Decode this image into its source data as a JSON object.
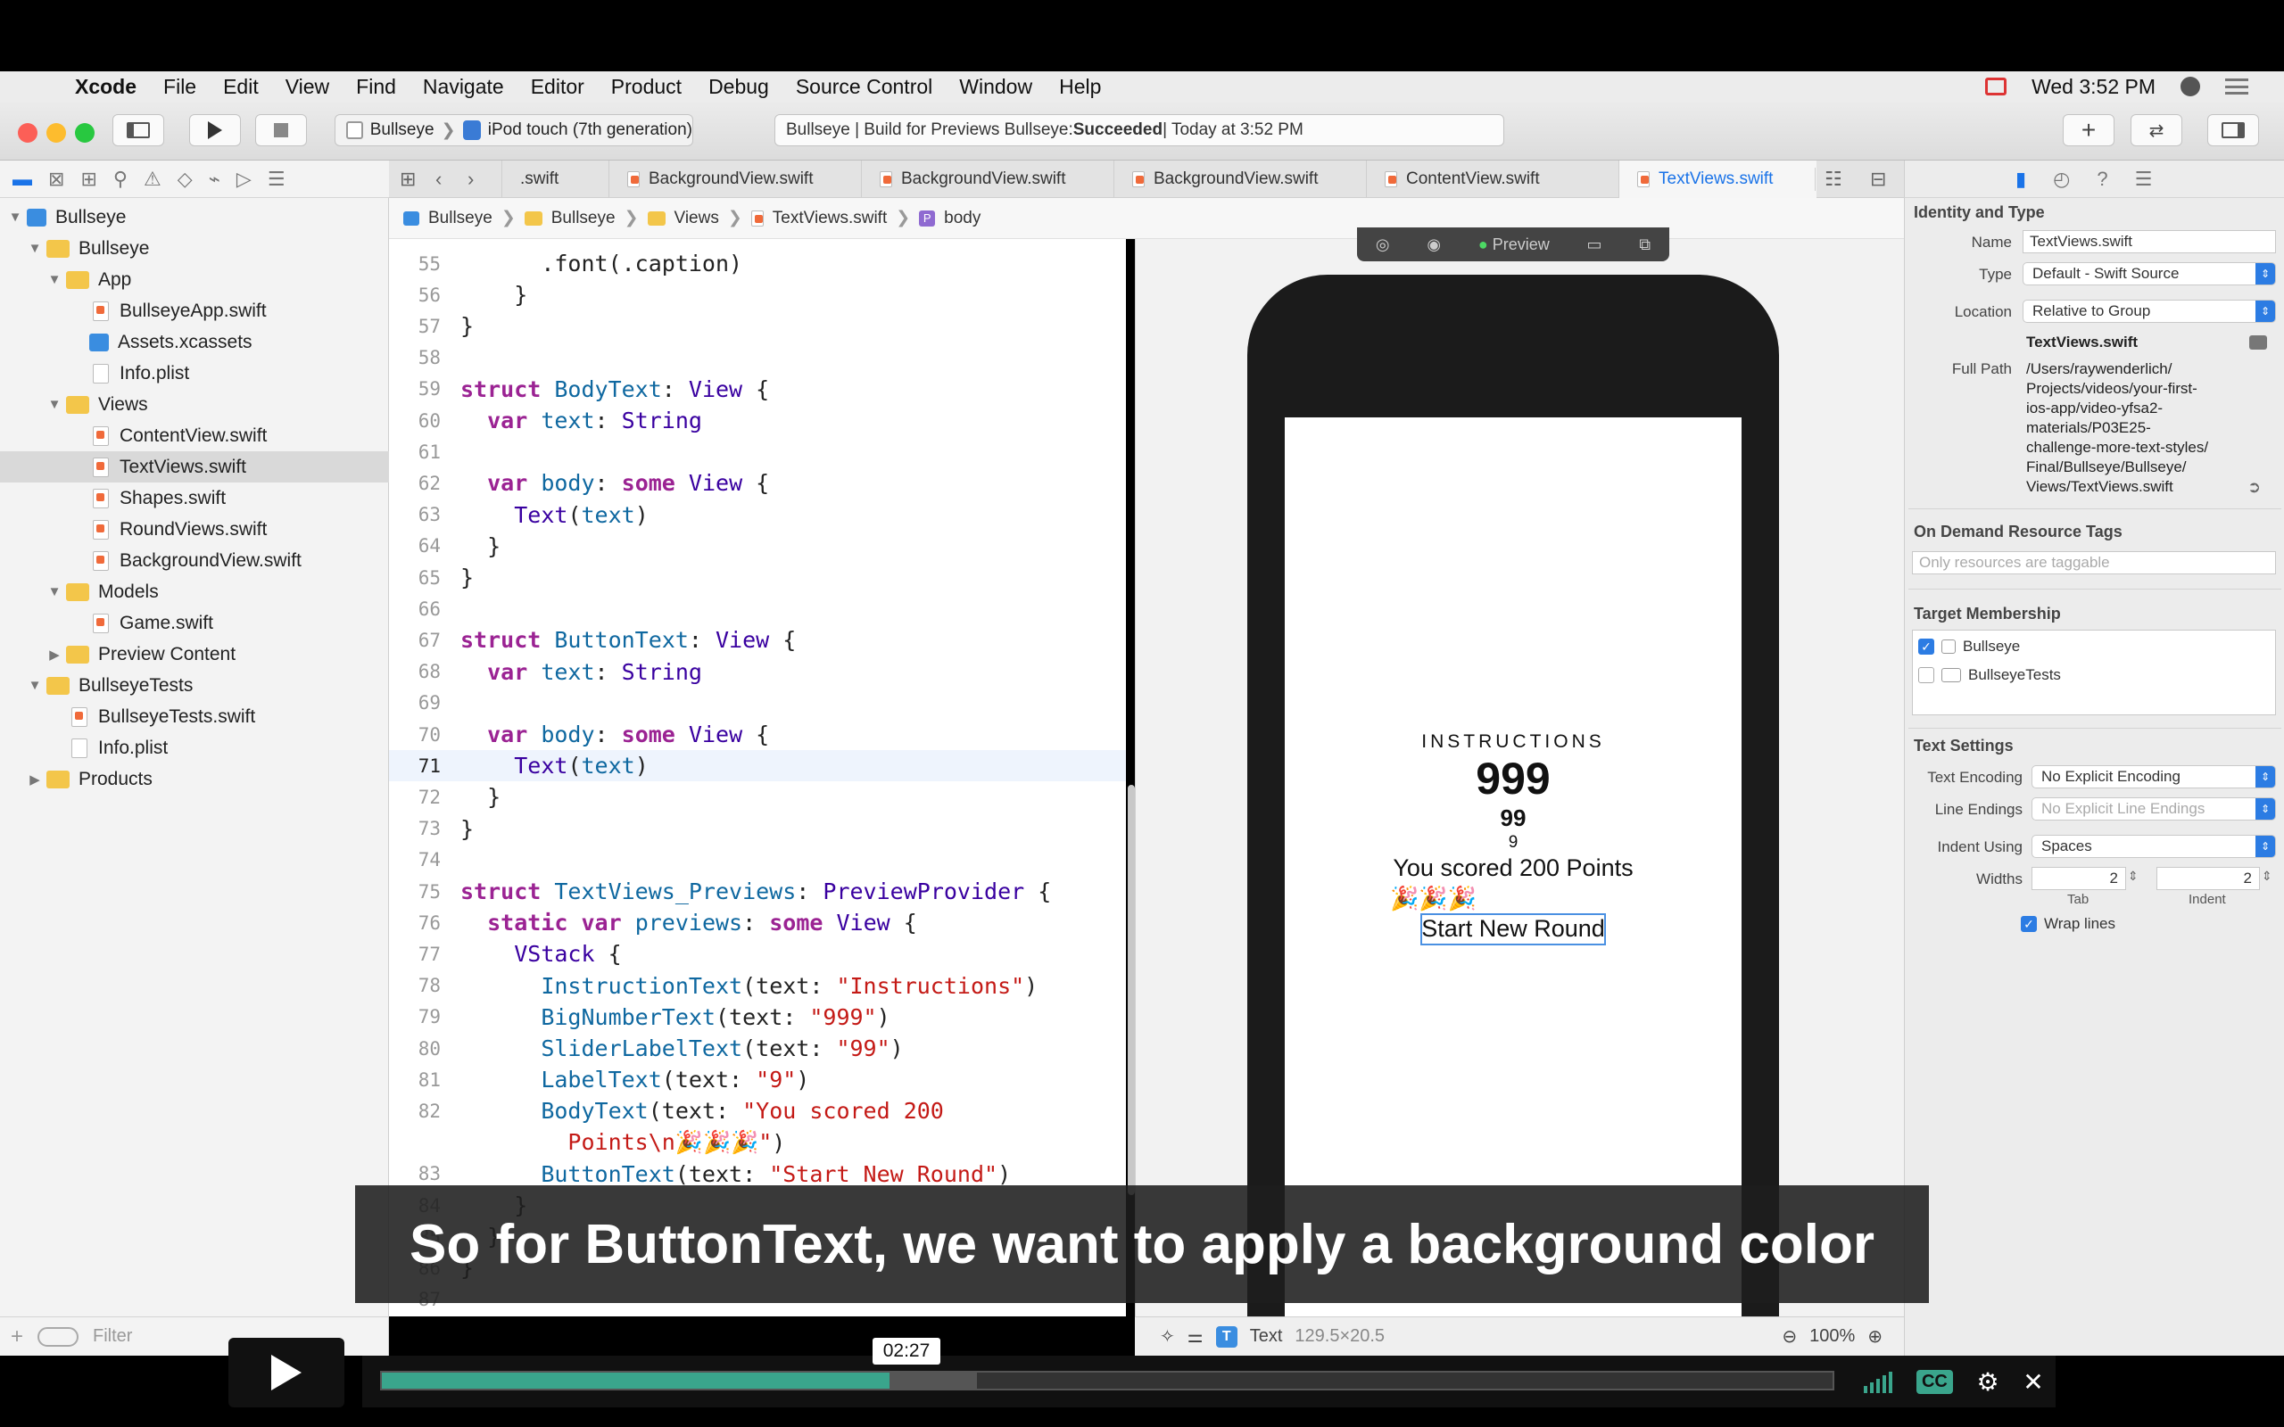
{
  "menubar": {
    "app": "Xcode",
    "items": [
      "File",
      "Edit",
      "View",
      "Find",
      "Navigate",
      "Editor",
      "Product",
      "Debug",
      "Source Control",
      "Window",
      "Help"
    ],
    "clock": "Wed 3:52 PM"
  },
  "toolbar": {
    "scheme": "Bullseye",
    "device": "iPod touch (7th generation)",
    "status_prefix": "Bullseye | Build for Previews Bullseye: ",
    "status_result": "Succeeded",
    "status_time": " | Today at 3:52 PM"
  },
  "tabs": [
    {
      "label": ".swift"
    },
    {
      "label": "BackgroundView.swift"
    },
    {
      "label": "BackgroundView.swift"
    },
    {
      "label": "BackgroundView.swift"
    },
    {
      "label": "ContentView.swift"
    },
    {
      "label": "TextViews.swift",
      "active": true
    }
  ],
  "breadcrumb": [
    "Bullseye",
    "Bullseye",
    "Views",
    "TextViews.swift",
    "body"
  ],
  "navigator": {
    "items": [
      {
        "label": "Bullseye",
        "type": "project"
      },
      {
        "label": "Bullseye",
        "type": "folder"
      },
      {
        "label": "App",
        "type": "folder"
      },
      {
        "label": "BullseyeApp.swift",
        "type": "swift"
      },
      {
        "label": "Assets.xcassets",
        "type": "assets"
      },
      {
        "label": "Info.plist",
        "type": "file"
      },
      {
        "label": "Views",
        "type": "folder"
      },
      {
        "label": "ContentView.swift",
        "type": "swift"
      },
      {
        "label": "TextViews.swift",
        "type": "swift",
        "selected": true
      },
      {
        "label": "Shapes.swift",
        "type": "swift"
      },
      {
        "label": "RoundViews.swift",
        "type": "swift"
      },
      {
        "label": "BackgroundView.swift",
        "type": "swift"
      },
      {
        "label": "Models",
        "type": "folder"
      },
      {
        "label": "Game.swift",
        "type": "swift"
      },
      {
        "label": "Preview Content",
        "type": "folder"
      },
      {
        "label": "BullseyeTests",
        "type": "folder"
      },
      {
        "label": "BullseyeTests.swift",
        "type": "swift"
      },
      {
        "label": "Info.plist",
        "type": "file"
      },
      {
        "label": "Products",
        "type": "folder"
      }
    ],
    "filter_placeholder": "Filter"
  },
  "code": {
    "current_line": "71",
    "lines": [
      {
        "n": "55",
        "tokens": [
          [
            "      ",
            ""
          ],
          [
            ".font(.caption)",
            ""
          ]
        ]
      },
      {
        "n": "56",
        "tokens": [
          [
            "    }",
            ""
          ]
        ]
      },
      {
        "n": "57",
        "tokens": [
          [
            "}",
            ""
          ]
        ]
      },
      {
        "n": "58",
        "tokens": []
      },
      {
        "n": "59",
        "tokens": [
          [
            "struct",
            "k"
          ],
          [
            " BodyText",
            "f"
          ],
          [
            ": ",
            ""
          ],
          [
            "View",
            "t"
          ],
          [
            " {",
            ""
          ]
        ]
      },
      {
        "n": "60",
        "tokens": [
          [
            "  ",
            ""
          ],
          [
            "var",
            "k"
          ],
          [
            " text",
            "f"
          ],
          [
            ": ",
            ""
          ],
          [
            "String",
            "t"
          ]
        ]
      },
      {
        "n": "61",
        "tokens": []
      },
      {
        "n": "62",
        "tokens": [
          [
            "  ",
            ""
          ],
          [
            "var",
            "k"
          ],
          [
            " body",
            "f"
          ],
          [
            ": ",
            ""
          ],
          [
            "some",
            "k"
          ],
          [
            " View",
            "t"
          ],
          [
            " {",
            ""
          ]
        ]
      },
      {
        "n": "63",
        "tokens": [
          [
            "    ",
            ""
          ],
          [
            "Text",
            "t"
          ],
          [
            "(",
            ""
          ],
          [
            "text",
            "f"
          ],
          [
            ")",
            ""
          ]
        ]
      },
      {
        "n": "64",
        "tokens": [
          [
            "  }",
            ""
          ]
        ]
      },
      {
        "n": "65",
        "tokens": [
          [
            "}",
            ""
          ]
        ]
      },
      {
        "n": "66",
        "tokens": []
      },
      {
        "n": "67",
        "tokens": [
          [
            "struct",
            "k"
          ],
          [
            " ButtonText",
            "f"
          ],
          [
            ": ",
            ""
          ],
          [
            "View",
            "t"
          ],
          [
            " {",
            ""
          ]
        ]
      },
      {
        "n": "68",
        "tokens": [
          [
            "  ",
            ""
          ],
          [
            "var",
            "k"
          ],
          [
            " text",
            "f"
          ],
          [
            ": ",
            ""
          ],
          [
            "String",
            "t"
          ]
        ]
      },
      {
        "n": "69",
        "tokens": []
      },
      {
        "n": "70",
        "tokens": [
          [
            "  ",
            ""
          ],
          [
            "var",
            "k"
          ],
          [
            " body",
            "f"
          ],
          [
            ": ",
            ""
          ],
          [
            "some",
            "k"
          ],
          [
            " View",
            "t"
          ],
          [
            " {",
            ""
          ]
        ]
      },
      {
        "n": "71",
        "tokens": [
          [
            "    ",
            ""
          ],
          [
            "Text",
            "t"
          ],
          [
            "(",
            ""
          ],
          [
            "text",
            "f"
          ],
          [
            ")",
            ""
          ]
        ]
      },
      {
        "n": "72",
        "tokens": [
          [
            "  }",
            ""
          ]
        ]
      },
      {
        "n": "73",
        "tokens": [
          [
            "}",
            ""
          ]
        ]
      },
      {
        "n": "74",
        "tokens": []
      },
      {
        "n": "75",
        "tokens": [
          [
            "struct",
            "k"
          ],
          [
            " TextViews_Previews",
            "f"
          ],
          [
            ": ",
            ""
          ],
          [
            "PreviewProvider",
            "t"
          ],
          [
            " {",
            ""
          ]
        ]
      },
      {
        "n": "76",
        "tokens": [
          [
            "  ",
            ""
          ],
          [
            "static",
            "k"
          ],
          [
            " ",
            ""
          ],
          [
            "var",
            "k"
          ],
          [
            " previews",
            "f"
          ],
          [
            ": ",
            ""
          ],
          [
            "some",
            "k"
          ],
          [
            " View",
            "t"
          ],
          [
            " {",
            ""
          ]
        ]
      },
      {
        "n": "77",
        "tokens": [
          [
            "    ",
            ""
          ],
          [
            "VStack",
            "t"
          ],
          [
            " {",
            ""
          ]
        ]
      },
      {
        "n": "78",
        "tokens": [
          [
            "      ",
            ""
          ],
          [
            "InstructionText",
            "f"
          ],
          [
            "(text: ",
            ""
          ],
          [
            "\"Instructions\"",
            "s"
          ],
          [
            ")",
            ""
          ]
        ]
      },
      {
        "n": "79",
        "tokens": [
          [
            "      ",
            ""
          ],
          [
            "BigNumberText",
            "f"
          ],
          [
            "(text: ",
            ""
          ],
          [
            "\"999\"",
            "s"
          ],
          [
            ")",
            ""
          ]
        ]
      },
      {
        "n": "80",
        "tokens": [
          [
            "      ",
            ""
          ],
          [
            "SliderLabelText",
            "f"
          ],
          [
            "(text: ",
            ""
          ],
          [
            "\"99\"",
            "s"
          ],
          [
            ")",
            ""
          ]
        ]
      },
      {
        "n": "81",
        "tokens": [
          [
            "      ",
            ""
          ],
          [
            "LabelText",
            "f"
          ],
          [
            "(text: ",
            ""
          ],
          [
            "\"9\"",
            "s"
          ],
          [
            ")",
            ""
          ]
        ]
      },
      {
        "n": "82",
        "tokens": [
          [
            "      ",
            ""
          ],
          [
            "BodyText",
            "f"
          ],
          [
            "(text: ",
            ""
          ],
          [
            "\"You scored 200",
            "s"
          ]
        ]
      },
      {
        "n": "",
        "tokens": [
          [
            "        ",
            ""
          ],
          [
            "Points\\n🎉🎉🎉\"",
            "s"
          ],
          [
            ")",
            ""
          ]
        ]
      },
      {
        "n": "83",
        "tokens": [
          [
            "      ",
            ""
          ],
          [
            "ButtonText",
            "f"
          ],
          [
            "(text: ",
            ""
          ],
          [
            "\"Start New Round\"",
            "s"
          ],
          [
            ")",
            ""
          ]
        ]
      },
      {
        "n": "84",
        "tokens": [
          [
            "    }",
            ""
          ]
        ]
      },
      {
        "n": "85",
        "tokens": [
          [
            "  }",
            ""
          ]
        ]
      },
      {
        "n": "86",
        "tokens": [
          [
            "}",
            ""
          ]
        ]
      },
      {
        "n": "87",
        "tokens": []
      }
    ]
  },
  "preview": {
    "toolbar_label": "Preview",
    "instructions": "INSTRUCTIONS",
    "big_number": "999",
    "slider_label": "99",
    "label": "9",
    "body": "You scored 200 Points",
    "emoji": "🎉🎉🎉",
    "button": "Start New Round"
  },
  "canvas_status": {
    "element": "Text",
    "size": "129.5×20.5",
    "zoom": "100%"
  },
  "inspector": {
    "identity_header": "Identity and Type",
    "name_label": "Name",
    "name_value": "TextViews.swift",
    "type_label": "Type",
    "type_value": "Default - Swift Source",
    "location_label": "Location",
    "location_value": "Relative to Group",
    "location_file": "TextViews.swift",
    "fullpath_label": "Full Path",
    "fullpath_lines": [
      "/Users/raywenderlich/",
      "Projects/videos/your-first-",
      "ios-app/video-yfsa2-",
      "materials/P03E25-",
      "challenge-more-text-styles/",
      "Final/Bullseye/Bullseye/",
      "Views/TextViews.swift"
    ],
    "odr_header": "On Demand Resource Tags",
    "odr_placeholder": "Only resources are taggable",
    "target_header": "Target Membership",
    "targets": [
      {
        "label": "Bullseye",
        "checked": true
      },
      {
        "label": "BullseyeTests",
        "checked": false
      }
    ],
    "text_header": "Text Settings",
    "encoding_label": "Text Encoding",
    "encoding_value": "No Explicit Encoding",
    "endings_label": "Line Endings",
    "endings_value": "No Explicit Line Endings",
    "indent_label": "Indent Using",
    "indent_value": "Spaces",
    "widths_label": "Widths",
    "tab_value": "2",
    "indent_width_value": "2",
    "tab_caption": "Tab",
    "indent_caption": "Indent",
    "wrap_label": "Wrap lines"
  },
  "video": {
    "caption": "So for ButtonText, we want to apply a background color",
    "time": "02:27",
    "progress": 0.35,
    "buffered": 0.41,
    "cc_label": "CC"
  }
}
